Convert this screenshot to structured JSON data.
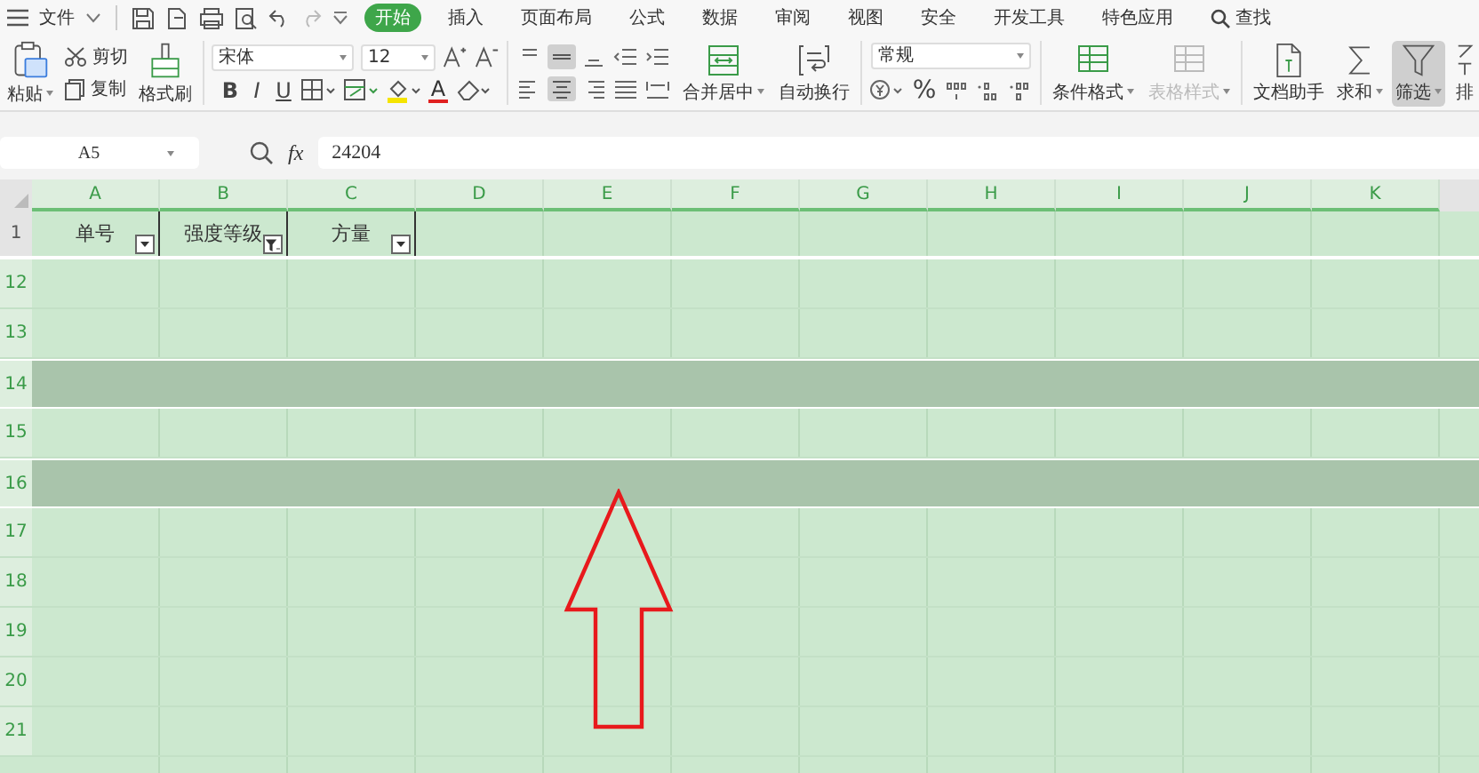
{
  "menu": {
    "file": "文件",
    "tabs": [
      {
        "label": "开始",
        "selected": true
      },
      {
        "label": "插入",
        "selected": false
      },
      {
        "label": "页面布局",
        "selected": false
      },
      {
        "label": "公式",
        "selected": false
      },
      {
        "label": "数据",
        "selected": false
      },
      {
        "label": "审阅",
        "selected": false
      },
      {
        "label": "视图",
        "selected": false
      },
      {
        "label": "安全",
        "selected": false
      },
      {
        "label": "开发工具",
        "selected": false
      },
      {
        "label": "特色应用",
        "selected": false
      }
    ],
    "search": "查找"
  },
  "clipboard": {
    "paste": "粘贴",
    "cut": "剪切",
    "copy": "复制",
    "format_painter": "格式刷"
  },
  "font": {
    "name": "宋体",
    "size": "12",
    "styles": [
      {
        "glyph": "B",
        "kind": "bold"
      },
      {
        "glyph": "I",
        "kind": "italic"
      },
      {
        "glyph": "U",
        "kind": "underline"
      }
    ],
    "color_glyph": "A"
  },
  "align": {
    "merge": "合并居中",
    "wrap": "自动换行"
  },
  "number": {
    "format": "常规",
    "percent": "%"
  },
  "styles": [
    {
      "label": "条件格式",
      "disabled": false
    },
    {
      "label": "表格样式",
      "disabled": true
    }
  ],
  "tools": [
    {
      "label": "文档助手",
      "kind": "doc",
      "selected": false
    },
    {
      "label": "求和",
      "kind": "sum",
      "selected": false
    },
    {
      "label": "筛选",
      "kind": "filter",
      "selected": true
    },
    {
      "label": "排",
      "kind": "sort",
      "selected": false
    }
  ],
  "formula_bar": {
    "cell": "A5",
    "fx": "fx",
    "value": "24204"
  },
  "columns": [
    "A",
    "B",
    "C",
    "D",
    "E",
    "F",
    "G",
    "H",
    "I",
    "J",
    "K"
  ],
  "header_row": {
    "number": "1",
    "cells": [
      {
        "text": "单号",
        "filter_active": false
      },
      {
        "text": "强度等级",
        "filter_active": true
      },
      {
        "text": "方量",
        "filter_active": false
      }
    ]
  },
  "rows": [
    {
      "number": "12",
      "highlighted": false
    },
    {
      "number": "13",
      "highlighted": false
    },
    {
      "number": "14",
      "highlighted": true
    },
    {
      "number": "15",
      "highlighted": false
    },
    {
      "number": "16",
      "highlighted": true
    },
    {
      "number": "17",
      "highlighted": false
    },
    {
      "number": "18",
      "highlighted": false
    },
    {
      "number": "19",
      "highlighted": false
    },
    {
      "number": "20",
      "highlighted": false
    },
    {
      "number": "21",
      "highlighted": false
    }
  ]
}
